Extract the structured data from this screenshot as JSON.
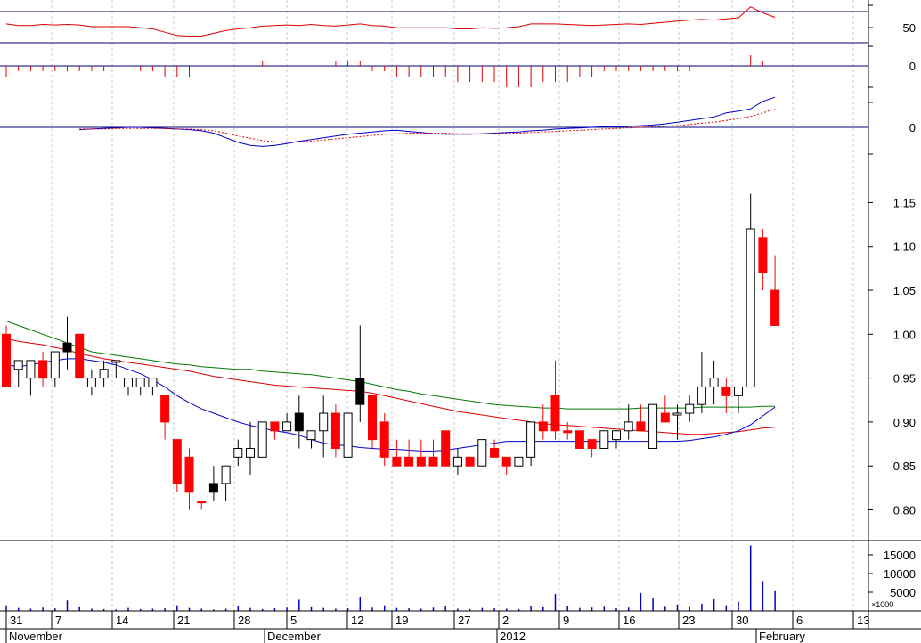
{
  "chart_data": {
    "type": "candlestick",
    "grid": true,
    "x_day_labels": [
      "31",
      "7",
      "14",
      "21",
      "28",
      "5",
      "12",
      "19",
      "27",
      "2",
      "9",
      "16",
      "23",
      "30",
      "6",
      "13"
    ],
    "x_month_labels": [
      "November",
      "December",
      "2012",
      "February"
    ],
    "price_panel": {
      "ylim": [
        0.765,
        1.19
      ],
      "yticks": [
        "0.80",
        "0.85",
        "0.90",
        "0.95",
        "1.00",
        "1.05",
        "1.10",
        "1.15"
      ],
      "candles": [
        {
          "o": 0.94,
          "h": 1.01,
          "l": 0.94,
          "c": 1.0,
          "color": "red"
        },
        {
          "o": 0.96,
          "h": 0.97,
          "l": 0.94,
          "c": 0.97,
          "color": "white"
        },
        {
          "o": 0.95,
          "h": 0.97,
          "l": 0.93,
          "c": 0.97,
          "color": "white"
        },
        {
          "o": 0.97,
          "h": 0.98,
          "l": 0.94,
          "c": 0.95,
          "color": "red"
        },
        {
          "o": 0.95,
          "h": 0.98,
          "l": 0.94,
          "c": 0.98,
          "color": "white"
        },
        {
          "o": 0.98,
          "h": 1.02,
          "l": 0.96,
          "c": 0.99,
          "color": "black"
        },
        {
          "o": 1.0,
          "h": 1.0,
          "l": 0.95,
          "c": 0.95,
          "color": "red"
        },
        {
          "o": 0.95,
          "h": 0.96,
          "l": 0.93,
          "c": 0.94,
          "color": "white"
        },
        {
          "o": 0.95,
          "h": 0.97,
          "l": 0.94,
          "c": 0.96,
          "color": "white"
        },
        {
          "o": 0.97,
          "h": 0.97,
          "l": 0.95,
          "c": 0.97,
          "color": "white"
        },
        {
          "o": 0.95,
          "h": 0.95,
          "l": 0.93,
          "c": 0.94,
          "color": "white"
        },
        {
          "o": 0.95,
          "h": 0.95,
          "l": 0.93,
          "c": 0.94,
          "color": "white"
        },
        {
          "o": 0.94,
          "h": 0.95,
          "l": 0.93,
          "c": 0.95,
          "color": "white"
        },
        {
          "o": 0.93,
          "h": 0.93,
          "l": 0.88,
          "c": 0.9,
          "color": "red"
        },
        {
          "o": 0.88,
          "h": 0.88,
          "l": 0.82,
          "c": 0.83,
          "color": "red"
        },
        {
          "o": 0.86,
          "h": 0.87,
          "l": 0.8,
          "c": 0.82,
          "color": "red"
        },
        {
          "o": 0.81,
          "h": 0.81,
          "l": 0.8,
          "c": 0.81,
          "color": "red"
        },
        {
          "o": 0.82,
          "h": 0.85,
          "l": 0.81,
          "c": 0.83,
          "color": "black"
        },
        {
          "o": 0.83,
          "h": 0.85,
          "l": 0.81,
          "c": 0.85,
          "color": "white"
        },
        {
          "o": 0.86,
          "h": 0.88,
          "l": 0.85,
          "c": 0.87,
          "color": "white"
        },
        {
          "o": 0.86,
          "h": 0.9,
          "l": 0.84,
          "c": 0.87,
          "color": "white"
        },
        {
          "o": 0.86,
          "h": 0.9,
          "l": 0.86,
          "c": 0.9,
          "color": "white"
        },
        {
          "o": 0.9,
          "h": 0.9,
          "l": 0.88,
          "c": 0.89,
          "color": "red"
        },
        {
          "o": 0.89,
          "h": 0.91,
          "l": 0.89,
          "c": 0.9,
          "color": "white"
        },
        {
          "o": 0.91,
          "h": 0.93,
          "l": 0.87,
          "c": 0.89,
          "color": "black"
        },
        {
          "o": 0.88,
          "h": 0.89,
          "l": 0.87,
          "c": 0.89,
          "color": "white"
        },
        {
          "o": 0.89,
          "h": 0.93,
          "l": 0.86,
          "c": 0.91,
          "color": "white"
        },
        {
          "o": 0.91,
          "h": 0.92,
          "l": 0.86,
          "c": 0.87,
          "color": "red"
        },
        {
          "o": 0.86,
          "h": 0.91,
          "l": 0.86,
          "c": 0.91,
          "color": "white"
        },
        {
          "o": 0.95,
          "h": 1.01,
          "l": 0.9,
          "c": 0.92,
          "color": "black"
        },
        {
          "o": 0.93,
          "h": 0.93,
          "l": 0.87,
          "c": 0.88,
          "color": "red"
        },
        {
          "o": 0.9,
          "h": 0.91,
          "l": 0.85,
          "c": 0.86,
          "color": "red"
        },
        {
          "o": 0.86,
          "h": 0.88,
          "l": 0.85,
          "c": 0.85,
          "color": "red"
        },
        {
          "o": 0.86,
          "h": 0.88,
          "l": 0.85,
          "c": 0.85,
          "color": "red"
        },
        {
          "o": 0.86,
          "h": 0.88,
          "l": 0.85,
          "c": 0.85,
          "color": "red"
        },
        {
          "o": 0.86,
          "h": 0.88,
          "l": 0.85,
          "c": 0.85,
          "color": "red"
        },
        {
          "o": 0.89,
          "h": 0.89,
          "l": 0.85,
          "c": 0.85,
          "color": "red"
        },
        {
          "o": 0.86,
          "h": 0.87,
          "l": 0.84,
          "c": 0.85,
          "color": "white"
        },
        {
          "o": 0.86,
          "h": 0.86,
          "l": 0.85,
          "c": 0.85,
          "color": "red"
        },
        {
          "o": 0.85,
          "h": 0.88,
          "l": 0.85,
          "c": 0.88,
          "color": "white"
        },
        {
          "o": 0.87,
          "h": 0.88,
          "l": 0.86,
          "c": 0.86,
          "color": "red"
        },
        {
          "o": 0.86,
          "h": 0.86,
          "l": 0.84,
          "c": 0.85,
          "color": "red"
        },
        {
          "o": 0.85,
          "h": 0.86,
          "l": 0.85,
          "c": 0.86,
          "color": "white"
        },
        {
          "o": 0.86,
          "h": 0.9,
          "l": 0.85,
          "c": 0.9,
          "color": "white"
        },
        {
          "o": 0.9,
          "h": 0.92,
          "l": 0.88,
          "c": 0.89,
          "color": "red"
        },
        {
          "o": 0.93,
          "h": 0.97,
          "l": 0.88,
          "c": 0.89,
          "color": "red"
        },
        {
          "o": 0.89,
          "h": 0.9,
          "l": 0.88,
          "c": 0.89,
          "color": "red"
        },
        {
          "o": 0.89,
          "h": 0.89,
          "l": 0.87,
          "c": 0.87,
          "color": "red"
        },
        {
          "o": 0.88,
          "h": 0.88,
          "l": 0.86,
          "c": 0.87,
          "color": "red"
        },
        {
          "o": 0.87,
          "h": 0.89,
          "l": 0.87,
          "c": 0.89,
          "color": "white"
        },
        {
          "o": 0.88,
          "h": 0.89,
          "l": 0.87,
          "c": 0.89,
          "color": "white"
        },
        {
          "o": 0.89,
          "h": 0.92,
          "l": 0.88,
          "c": 0.9,
          "color": "white"
        },
        {
          "o": 0.9,
          "h": 0.92,
          "l": 0.89,
          "c": 0.89,
          "color": "red"
        },
        {
          "o": 0.87,
          "h": 0.92,
          "l": 0.87,
          "c": 0.92,
          "color": "white"
        },
        {
          "o": 0.91,
          "h": 0.93,
          "l": 0.9,
          "c": 0.9,
          "color": "red"
        },
        {
          "o": 0.91,
          "h": 0.92,
          "l": 0.88,
          "c": 0.91,
          "color": "white"
        },
        {
          "o": 0.91,
          "h": 0.93,
          "l": 0.9,
          "c": 0.92,
          "color": "white"
        },
        {
          "o": 0.92,
          "h": 0.98,
          "l": 0.91,
          "c": 0.94,
          "color": "white"
        },
        {
          "o": 0.94,
          "h": 0.97,
          "l": 0.92,
          "c": 0.95,
          "color": "white"
        },
        {
          "o": 0.94,
          "h": 0.95,
          "l": 0.91,
          "c": 0.93,
          "color": "red"
        },
        {
          "o": 0.93,
          "h": 0.94,
          "l": 0.91,
          "c": 0.94,
          "color": "white"
        },
        {
          "o": 0.94,
          "h": 1.16,
          "l": 0.94,
          "c": 1.12,
          "color": "white"
        },
        {
          "o": 1.11,
          "h": 1.12,
          "l": 1.05,
          "c": 1.07,
          "color": "red"
        },
        {
          "o": 1.05,
          "h": 1.09,
          "l": 1.01,
          "c": 1.01,
          "color": "red"
        }
      ],
      "ma_green": [
        1.015,
        1.01,
        1.005,
        1.0,
        0.995,
        0.99,
        0.985,
        0.98,
        0.978,
        0.976,
        0.974,
        0.972,
        0.97,
        0.968,
        0.966,
        0.965,
        0.963,
        0.962,
        0.961,
        0.96,
        0.96,
        0.958,
        0.957,
        0.956,
        0.955,
        0.954,
        0.952,
        0.95,
        0.948,
        0.946,
        0.943,
        0.94,
        0.937,
        0.935,
        0.932,
        0.93,
        0.928,
        0.926,
        0.924,
        0.922,
        0.92,
        0.919,
        0.918,
        0.917,
        0.916,
        0.916,
        0.915,
        0.915,
        0.915,
        0.915,
        0.915,
        0.915,
        0.916,
        0.916,
        0.916,
        0.916,
        0.916,
        0.917,
        0.917,
        0.917,
        0.917,
        0.917,
        0.918,
        0.918
      ],
      "ma_red": [
        0.995,
        0.992,
        0.99,
        0.988,
        0.985,
        0.982,
        0.978,
        0.975,
        0.972,
        0.97,
        0.968,
        0.966,
        0.964,
        0.962,
        0.96,
        0.958,
        0.955,
        0.952,
        0.95,
        0.948,
        0.946,
        0.944,
        0.942,
        0.941,
        0.94,
        0.939,
        0.938,
        0.937,
        0.936,
        0.935,
        0.933,
        0.93,
        0.927,
        0.924,
        0.921,
        0.918,
        0.915,
        0.912,
        0.91,
        0.908,
        0.906,
        0.904,
        0.902,
        0.9,
        0.898,
        0.897,
        0.896,
        0.895,
        0.894,
        0.893,
        0.892,
        0.891,
        0.89,
        0.889,
        0.888,
        0.887,
        0.886,
        0.886,
        0.887,
        0.888,
        0.889,
        0.891,
        0.893,
        0.894
      ],
      "ma_blue": [
        0.965,
        0.963,
        0.965,
        0.968,
        0.97,
        0.972,
        0.972,
        0.97,
        0.968,
        0.965,
        0.96,
        0.955,
        0.948,
        0.94,
        0.93,
        0.922,
        0.915,
        0.91,
        0.905,
        0.9,
        0.896,
        0.893,
        0.89,
        0.888,
        0.885,
        0.88,
        0.876,
        0.874,
        0.873,
        0.871,
        0.87,
        0.869,
        0.869,
        0.868,
        0.867,
        0.867,
        0.868,
        0.87,
        0.872,
        0.874,
        0.876,
        0.878,
        0.878,
        0.878,
        0.878,
        0.878,
        0.878,
        0.878,
        0.878,
        0.878,
        0.878,
        0.878,
        0.878,
        0.878,
        0.878,
        0.878,
        0.879,
        0.881,
        0.883,
        0.886,
        0.89,
        0.897,
        0.907,
        0.917
      ]
    },
    "rsi_panel": {
      "ytick_labels": [
        "50"
      ],
      "values": [
        55,
        52,
        52,
        54,
        53,
        54,
        53,
        50,
        50,
        50,
        50,
        48,
        46,
        40,
        34,
        33,
        33,
        38,
        43,
        46,
        48,
        51,
        52,
        53,
        52,
        54,
        52,
        51,
        53,
        55,
        52,
        51,
        48,
        48,
        48,
        48,
        48,
        46,
        46,
        48,
        47,
        48,
        50,
        55,
        55,
        55,
        54,
        53,
        52,
        53,
        54,
        55,
        54,
        56,
        58,
        60,
        62,
        63,
        62,
        64,
        66,
        86,
        75,
        67
      ]
    },
    "momentum_panel": {
      "ytick_labels": [
        "0"
      ],
      "values": [
        -2,
        -1,
        -1,
        -1,
        -1,
        -1,
        -1,
        -1,
        -1,
        0,
        0,
        -1,
        -1,
        -2,
        -2,
        -2,
        0,
        0,
        0,
        0,
        0,
        1,
        0,
        0,
        0,
        0,
        0,
        1,
        1,
        1,
        -1,
        -1,
        -2,
        -2,
        -2,
        -2,
        -2,
        -3,
        -3,
        -3,
        -3,
        -4,
        -4,
        -4,
        -3,
        -3,
        -3,
        -2,
        -2,
        -1,
        -1,
        -1,
        -1,
        -1,
        -1,
        -1,
        -1,
        0,
        0,
        0,
        0,
        2,
        1,
        0
      ]
    },
    "macd_panel": {
      "ytick_labels": [
        "0"
      ],
      "macd": [
        -0.004,
        -0.003,
        -0.002,
        -0.001,
        0.0,
        0.0,
        -0.001,
        -0.002,
        -0.003,
        -0.004,
        -0.006,
        -0.01,
        -0.018,
        -0.026,
        -0.031,
        -0.033,
        -0.031,
        -0.028,
        -0.024,
        -0.021,
        -0.018,
        -0.015,
        -0.012,
        -0.01,
        -0.008,
        -0.006,
        -0.005,
        -0.007,
        -0.009,
        -0.011,
        -0.012,
        -0.012,
        -0.012,
        -0.011,
        -0.01,
        -0.009,
        -0.008,
        -0.006,
        -0.005,
        -0.003,
        -0.002,
        -0.001,
        0.0,
        0.001,
        0.001,
        0.002,
        0.003,
        0.004,
        0.006,
        0.009,
        0.012,
        0.015,
        0.018,
        0.025,
        0.028,
        0.032,
        0.045,
        0.052
      ],
      "signal": [
        -0.003,
        -0.003,
        -0.003,
        -0.002,
        -0.002,
        -0.002,
        -0.002,
        -0.002,
        -0.003,
        -0.003,
        -0.004,
        -0.006,
        -0.01,
        -0.015,
        -0.019,
        -0.023,
        -0.025,
        -0.026,
        -0.025,
        -0.024,
        -0.022,
        -0.02,
        -0.018,
        -0.016,
        -0.014,
        -0.012,
        -0.011,
        -0.01,
        -0.01,
        -0.01,
        -0.01,
        -0.011,
        -0.011,
        -0.011,
        -0.011,
        -0.01,
        -0.01,
        -0.009,
        -0.008,
        -0.007,
        -0.006,
        -0.005,
        -0.004,
        -0.003,
        -0.002,
        -0.001,
        0.0,
        0.001,
        0.002,
        0.003,
        0.005,
        0.007,
        0.009,
        0.012,
        0.015,
        0.019,
        0.025,
        0.032
      ]
    },
    "volume_panel": {
      "ytick_labels": [
        "5000",
        "10000",
        "15000"
      ],
      "scale_label": "×1000",
      "values": [
        1500,
        800,
        600,
        900,
        700,
        2800,
        1000,
        600,
        500,
        400,
        800,
        500,
        600,
        700,
        1500,
        800,
        600,
        400,
        600,
        1300,
        800,
        500,
        700,
        900,
        3000,
        1000,
        800,
        600,
        700,
        3800,
        900,
        1500,
        800,
        700,
        600,
        900,
        1200,
        600,
        500,
        800,
        700,
        600,
        500,
        1200,
        1000,
        4500,
        1200,
        800,
        900,
        1100,
        700,
        900,
        4800,
        3500,
        1100,
        1700,
        1000,
        1900,
        3100,
        1500,
        2500,
        17500,
        8000,
        5300
      ]
    }
  }
}
